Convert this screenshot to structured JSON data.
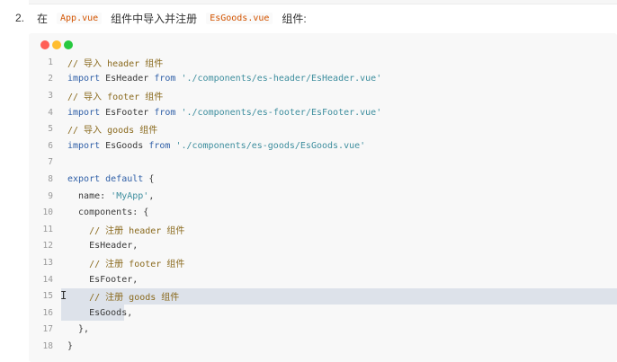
{
  "step": {
    "number": "2.",
    "text_before": "在",
    "file_app": "App.vue",
    "text_middle": "组件中导入并注册",
    "file_goods": "EsGoods.vue",
    "text_after": "组件:"
  },
  "window_dots": {
    "red": "#ff5f56",
    "yellow": "#ffbd2e",
    "green": "#27c93f"
  },
  "code_lines": [
    {
      "n": "1",
      "parts": [
        {
          "t": "// 导入 header 组件",
          "c": "cm"
        }
      ]
    },
    {
      "n": "2",
      "parts": [
        {
          "t": "import",
          "c": "kw"
        },
        {
          "t": " EsHeader ",
          "c": ""
        },
        {
          "t": "from",
          "c": "kw"
        },
        {
          "t": " ",
          "c": ""
        },
        {
          "t": "'./components/es-header/EsHeader.vue'",
          "c": "str"
        }
      ]
    },
    {
      "n": "3",
      "parts": [
        {
          "t": "// 导入 footer 组件",
          "c": "cm"
        }
      ]
    },
    {
      "n": "4",
      "parts": [
        {
          "t": "import",
          "c": "kw"
        },
        {
          "t": " EsFooter ",
          "c": ""
        },
        {
          "t": "from",
          "c": "kw"
        },
        {
          "t": " ",
          "c": ""
        },
        {
          "t": "'./components/es-footer/EsFooter.vue'",
          "c": "str"
        }
      ]
    },
    {
      "n": "5",
      "parts": [
        {
          "t": "// 导入 goods 组件",
          "c": "cm"
        }
      ]
    },
    {
      "n": "6",
      "parts": [
        {
          "t": "import",
          "c": "kw"
        },
        {
          "t": " EsGoods ",
          "c": ""
        },
        {
          "t": "from",
          "c": "kw"
        },
        {
          "t": " ",
          "c": ""
        },
        {
          "t": "'./components/es-goods/EsGoods.vue'",
          "c": "str"
        }
      ]
    },
    {
      "n": "7",
      "parts": []
    },
    {
      "n": "8",
      "parts": [
        {
          "t": "export default",
          "c": "kw"
        },
        {
          "t": " {",
          "c": ""
        }
      ]
    },
    {
      "n": "9",
      "parts": [
        {
          "t": "  name: ",
          "c": ""
        },
        {
          "t": "'MyApp'",
          "c": "str"
        },
        {
          "t": ",",
          "c": ""
        }
      ]
    },
    {
      "n": "10",
      "parts": [
        {
          "t": "  components: {",
          "c": ""
        }
      ]
    },
    {
      "n": "11",
      "parts": [
        {
          "t": "    ",
          "c": ""
        },
        {
          "t": "// 注册 header 组件",
          "c": "cm"
        }
      ]
    },
    {
      "n": "12",
      "parts": [
        {
          "t": "    EsHeader,",
          "c": ""
        }
      ]
    },
    {
      "n": "13",
      "parts": [
        {
          "t": "    ",
          "c": ""
        },
        {
          "t": "// 注册 footer 组件",
          "c": "cm"
        }
      ]
    },
    {
      "n": "14",
      "parts": [
        {
          "t": "    EsFooter,",
          "c": ""
        }
      ]
    },
    {
      "n": "15",
      "parts": [
        {
          "t": "    ",
          "c": ""
        },
        {
          "t": "// 注册 goods 组件",
          "c": "cm"
        }
      ]
    },
    {
      "n": "16",
      "parts": [
        {
          "t": "    EsGoods,",
          "c": ""
        }
      ]
    },
    {
      "n": "17",
      "parts": [
        {
          "t": "  },",
          "c": ""
        }
      ]
    },
    {
      "n": "18",
      "parts": [
        {
          "t": "}",
          "c": ""
        }
      ]
    }
  ]
}
